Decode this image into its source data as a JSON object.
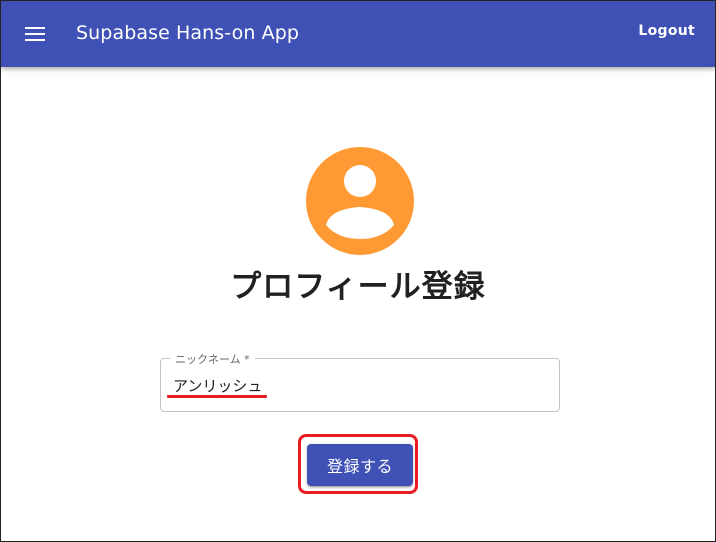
{
  "appbar": {
    "title": "Supabase Hans-on App",
    "logout_label": "Logout",
    "menu_icon": "hamburger-menu-icon",
    "bg_color": "#3f51b5"
  },
  "profile": {
    "avatar_icon": "account-circle-icon",
    "avatar_color": "#ff9933",
    "title": "プロフィール登録"
  },
  "form": {
    "nickname_label": "ニックネーム *",
    "nickname_value": "アンリッシュ",
    "submit_label": "登録する"
  },
  "annotations": {
    "highlight_color": "#e81c24"
  }
}
